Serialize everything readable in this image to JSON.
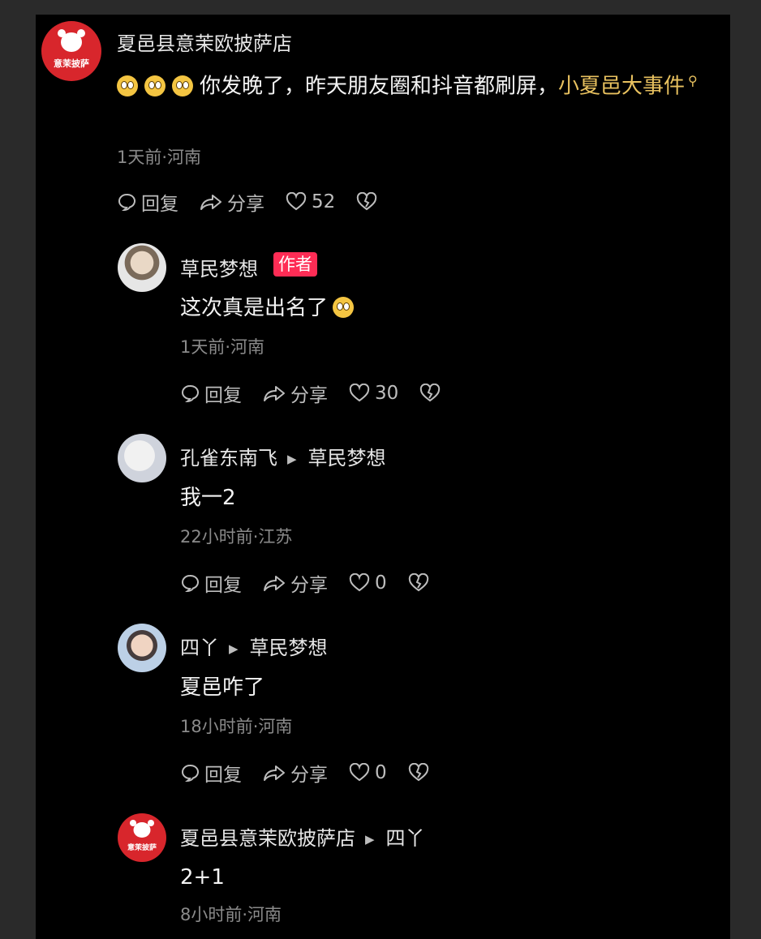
{
  "comments": [
    {
      "author": "夏邑县意茉欧披萨店",
      "avatar_label": "意茉披萨",
      "text_before": "你发晚了，昨天朋友圈和抖音都刷屏，",
      "text_link": "小夏邑大事件",
      "meta": "1天前·河南",
      "actions": {
        "reply": "回复",
        "share": "分享",
        "likes": "52"
      }
    },
    {
      "author": "草民梦想",
      "badge": "作者",
      "text": "这次真是出名了",
      "meta": "1天前·河南",
      "actions": {
        "reply": "回复",
        "share": "分享",
        "likes": "30"
      }
    },
    {
      "author": "孔雀东南飞",
      "reply_to": "草民梦想",
      "text": "我一2",
      "meta": "22小时前·江苏",
      "actions": {
        "reply": "回复",
        "share": "分享",
        "likes": "0"
      }
    },
    {
      "author": "四丫",
      "reply_to": "草民梦想",
      "text": "夏邑咋了",
      "meta": "18小时前·河南",
      "actions": {
        "reply": "回复",
        "share": "分享",
        "likes": "0"
      }
    },
    {
      "author": "夏邑县意茉欧披萨店",
      "avatar_label": "意茉披萨",
      "reply_to": "四丫",
      "text": "2+1",
      "meta": "8小时前·河南"
    }
  ],
  "icons": {
    "reply": "comment-bubble-icon",
    "share": "share-arrow-icon",
    "like": "heart-icon",
    "dislike": "broken-heart-icon",
    "search": "search-icon"
  },
  "colors": {
    "highlight": "#e8c15f",
    "badge": "#fe2c55",
    "background": "#000000"
  }
}
